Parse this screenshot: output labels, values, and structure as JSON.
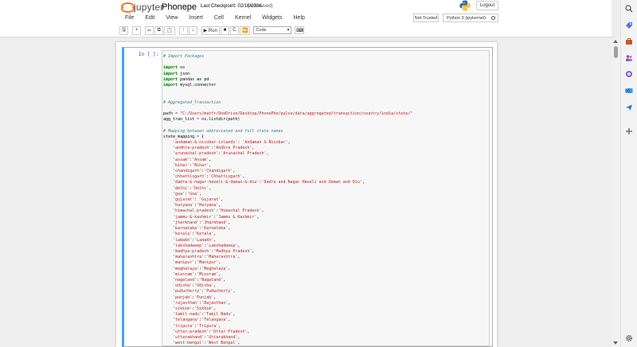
{
  "header": {
    "logo_text": "jupyter",
    "notebook_name": "Phonepe",
    "checkpoint": "Last Checkpoint: 02/10/2024",
    "autosave": "(autosaved)",
    "logout_label": "Logout",
    "trust_status": "Not Trusted",
    "kernel": "Python 3 (ipykernel)"
  },
  "menu": [
    "File",
    "Edit",
    "View",
    "Insert",
    "Cell",
    "Kernel",
    "Widgets",
    "Help"
  ],
  "toolbar": {
    "save": "🖫",
    "add": "+",
    "cut": "✂",
    "copy": "⧉",
    "paste": "📋",
    "up": "↑",
    "down": "↓",
    "run": "▶ Run",
    "stop": "■",
    "restart": "C",
    "restart_run": "⏩",
    "cell_type": "Code",
    "keyboard": "⌨"
  },
  "cell": {
    "prompt": "In [ ]:",
    "lines": [
      [
        [
          "c",
          "# Import Packages"
        ]
      ],
      [],
      [
        [
          "k",
          "import"
        ],
        [
          "t",
          " os"
        ]
      ],
      [
        [
          "k",
          "import"
        ],
        [
          "t",
          " json"
        ]
      ],
      [
        [
          "k",
          "import"
        ],
        [
          "t",
          " pandas "
        ],
        [
          "k",
          "as"
        ],
        [
          "t",
          " pd"
        ]
      ],
      [
        [
          "k",
          "import"
        ],
        [
          "t",
          " mysql.connector"
        ]
      ],
      [],
      [],
      [
        [
          "c",
          "# Aggregated_Transaction"
        ]
      ],
      [],
      [
        [
          "t",
          "path "
        ],
        [
          "o",
          "="
        ],
        [
          "t",
          " "
        ],
        [
          "s",
          "\"C:/Users/matfr/OneDrive/Desktop/PhonePhe/pulse/data/aggregated/transaction/country/india/state/\""
        ]
      ],
      [
        [
          "t",
          "agg_tran_list "
        ],
        [
          "o",
          "="
        ],
        [
          "t",
          " os.listdir(path)"
        ]
      ],
      [],
      [
        [
          "c",
          "# Mapping between abbreviated and full state names"
        ]
      ],
      [
        [
          "t",
          "state_mapping "
        ],
        [
          "o",
          "="
        ],
        [
          "t",
          " {"
        ]
      ],
      [
        [
          "t",
          "    "
        ],
        [
          "s",
          "'andaman-&-nicobar-islands'"
        ],
        [
          "t",
          ": "
        ],
        [
          "s",
          "'Andaman & Nicobar'"
        ],
        [
          "t",
          ","
        ]
      ],
      [
        [
          "t",
          "    "
        ],
        [
          "s",
          "'andhra-pradesh'"
        ],
        [
          "t",
          ":"
        ],
        [
          "s",
          "'Andhra Pradesh'"
        ],
        [
          "t",
          ","
        ]
      ],
      [
        [
          "t",
          "    "
        ],
        [
          "s",
          "'arunachal-pradesh'"
        ],
        [
          "t",
          ":"
        ],
        [
          "s",
          "'Arunachal Pradesh'"
        ],
        [
          "t",
          ","
        ]
      ],
      [
        [
          "t",
          "    "
        ],
        [
          "s",
          "'assam'"
        ],
        [
          "t",
          ":"
        ],
        [
          "s",
          "'Assam'"
        ],
        [
          "t",
          ","
        ]
      ],
      [
        [
          "t",
          "    "
        ],
        [
          "s",
          "'bihar'"
        ],
        [
          "t",
          ":"
        ],
        [
          "s",
          "'Bihar'"
        ],
        [
          "t",
          ","
        ]
      ],
      [
        [
          "t",
          "    "
        ],
        [
          "s",
          "'chandigarh'"
        ],
        [
          "t",
          ":"
        ],
        [
          "s",
          "'Chandigarh'"
        ],
        [
          "t",
          ","
        ]
      ],
      [
        [
          "t",
          "    "
        ],
        [
          "s",
          "'chhattisgarh'"
        ],
        [
          "t",
          ":"
        ],
        [
          "s",
          "'Chhattisgarh'"
        ],
        [
          "t",
          ","
        ]
      ],
      [
        [
          "t",
          "    "
        ],
        [
          "s",
          "'dadra-&-nagar-haveli-&-daman-&-diu'"
        ],
        [
          "t",
          ":"
        ],
        [
          "s",
          "'Dadra and Nagar Haveli and Daman and Diu'"
        ],
        [
          "t",
          ","
        ]
      ],
      [
        [
          "t",
          "    "
        ],
        [
          "s",
          "'delhi'"
        ],
        [
          "t",
          ":"
        ],
        [
          "s",
          "'Delhi'"
        ],
        [
          "t",
          ","
        ]
      ],
      [
        [
          "t",
          "    "
        ],
        [
          "s",
          "'goa'"
        ],
        [
          "t",
          ":"
        ],
        [
          "s",
          "'Goa'"
        ],
        [
          "t",
          ","
        ]
      ],
      [
        [
          "t",
          "    "
        ],
        [
          "s",
          "'gujarat'"
        ],
        [
          "t",
          ": "
        ],
        [
          "s",
          "'Gujarat'"
        ],
        [
          "t",
          ","
        ]
      ],
      [
        [
          "t",
          "    "
        ],
        [
          "s",
          "'haryana'"
        ],
        [
          "t",
          ":"
        ],
        [
          "s",
          "'Haryana'"
        ],
        [
          "t",
          ","
        ]
      ],
      [
        [
          "t",
          "    "
        ],
        [
          "s",
          "'himachal-pradesh'"
        ],
        [
          "t",
          ":"
        ],
        [
          "s",
          "'Himachal Pradesh'"
        ],
        [
          "t",
          ","
        ]
      ],
      [
        [
          "t",
          "    "
        ],
        [
          "s",
          "'jammu-&-kashmir'"
        ],
        [
          "t",
          ":"
        ],
        [
          "s",
          "'Jammu & Kashmir'"
        ],
        [
          "t",
          ","
        ]
      ],
      [
        [
          "t",
          "    "
        ],
        [
          "s",
          "'jharkhand'"
        ],
        [
          "t",
          ":"
        ],
        [
          "s",
          "'Jharkhand'"
        ],
        [
          "t",
          ","
        ]
      ],
      [
        [
          "t",
          "    "
        ],
        [
          "s",
          "'karnataka'"
        ],
        [
          "t",
          ":"
        ],
        [
          "s",
          "'Karnataka'"
        ],
        [
          "t",
          ","
        ]
      ],
      [
        [
          "t",
          "    "
        ],
        [
          "s",
          "'kerala'"
        ],
        [
          "t",
          ":"
        ],
        [
          "s",
          "'Kerala'"
        ],
        [
          "t",
          ","
        ]
      ],
      [
        [
          "t",
          "    "
        ],
        [
          "s",
          "'ladakh'"
        ],
        [
          "t",
          ":"
        ],
        [
          "s",
          "'Ladakh'"
        ],
        [
          "t",
          ","
        ]
      ],
      [
        [
          "t",
          "    "
        ],
        [
          "s",
          "'lakshadweep'"
        ],
        [
          "t",
          ":"
        ],
        [
          "s",
          "'Lakshadweep'"
        ],
        [
          "t",
          ","
        ]
      ],
      [
        [
          "t",
          "    "
        ],
        [
          "s",
          "'madhya-pradesh'"
        ],
        [
          "t",
          ":"
        ],
        [
          "s",
          "'Madhya Pradesh'"
        ],
        [
          "t",
          ","
        ]
      ],
      [
        [
          "t",
          "    "
        ],
        [
          "s",
          "'maharashtra'"
        ],
        [
          "t",
          ":"
        ],
        [
          "s",
          "'Maharashtra'"
        ],
        [
          "t",
          ","
        ]
      ],
      [
        [
          "t",
          "    "
        ],
        [
          "s",
          "'manipur'"
        ],
        [
          "t",
          ":"
        ],
        [
          "s",
          "'Manipur'"
        ],
        [
          "t",
          ","
        ]
      ],
      [
        [
          "t",
          "    "
        ],
        [
          "s",
          "'meghalaya'"
        ],
        [
          "t",
          ":"
        ],
        [
          "s",
          "'Meghalaya'"
        ],
        [
          "t",
          ","
        ]
      ],
      [
        [
          "t",
          "    "
        ],
        [
          "s",
          "'mizoram'"
        ],
        [
          "t",
          ":"
        ],
        [
          "s",
          "'Mizoram'"
        ],
        [
          "t",
          ","
        ]
      ],
      [
        [
          "t",
          "    "
        ],
        [
          "s",
          "'nagaland'"
        ],
        [
          "t",
          ":"
        ],
        [
          "s",
          "'Nagaland'"
        ],
        [
          "t",
          ","
        ]
      ],
      [
        [
          "t",
          "    "
        ],
        [
          "s",
          "'odisha'"
        ],
        [
          "t",
          ":"
        ],
        [
          "s",
          "'Odisha'"
        ],
        [
          "t",
          ","
        ]
      ],
      [
        [
          "t",
          "    "
        ],
        [
          "s",
          "'puducherry'"
        ],
        [
          "t",
          ":"
        ],
        [
          "s",
          "'Puducherry'"
        ],
        [
          "t",
          ","
        ]
      ],
      [
        [
          "t",
          "    "
        ],
        [
          "s",
          "'punjab'"
        ],
        [
          "t",
          ":"
        ],
        [
          "s",
          "'Punjab'"
        ],
        [
          "t",
          ","
        ]
      ],
      [
        [
          "t",
          "    "
        ],
        [
          "s",
          "'rajasthan'"
        ],
        [
          "t",
          ":"
        ],
        [
          "s",
          "'Rajasthan'"
        ],
        [
          "t",
          ","
        ]
      ],
      [
        [
          "t",
          "    "
        ],
        [
          "s",
          "'sikkim'"
        ],
        [
          "t",
          ":"
        ],
        [
          "s",
          "'Sikkim'"
        ],
        [
          "t",
          ","
        ]
      ],
      [
        [
          "t",
          "    "
        ],
        [
          "s",
          "'tamil-nadu'"
        ],
        [
          "t",
          ":"
        ],
        [
          "s",
          "'Tamil Nadu'"
        ],
        [
          "t",
          ","
        ]
      ],
      [
        [
          "t",
          "    "
        ],
        [
          "s",
          "'telangana'"
        ],
        [
          "t",
          ":"
        ],
        [
          "s",
          "'Telangana'"
        ],
        [
          "t",
          ","
        ]
      ],
      [
        [
          "t",
          "    "
        ],
        [
          "s",
          "'tripura'"
        ],
        [
          "t",
          ":"
        ],
        [
          "s",
          "'Tripura'"
        ],
        [
          "t",
          ","
        ]
      ],
      [
        [
          "t",
          "    "
        ],
        [
          "s",
          "'uttar-pradesh'"
        ],
        [
          "t",
          ":"
        ],
        [
          "s",
          "'Uttar Pradesh'"
        ],
        [
          "t",
          ","
        ]
      ],
      [
        [
          "t",
          "    "
        ],
        [
          "s",
          "'uttarakhand'"
        ],
        [
          "t",
          ":"
        ],
        [
          "s",
          "'Uttarakhand'"
        ],
        [
          "t",
          ","
        ]
      ],
      [
        [
          "t",
          "    "
        ],
        [
          "s",
          "'west-bengal'"
        ],
        [
          "t",
          ":"
        ],
        [
          "s",
          "'West Bengal'"
        ],
        [
          "t",
          ","
        ]
      ],
      [],
      [
        [
          "t",
          "}"
        ]
      ]
    ]
  },
  "colors": {
    "jupyter_orange": "#f37726",
    "cell_selected_border": "#42a5f5",
    "prompt_color": "#303f9f",
    "comment": "#408080",
    "keyword": "#008000",
    "string": "#ba2121"
  },
  "sidebar_icons": [
    "search-icon",
    "tag-icon",
    "briefcase-icon",
    "people-icon",
    "globe-icon",
    "outlook-icon",
    "send-icon",
    "add-icon",
    "settings-icon"
  ]
}
